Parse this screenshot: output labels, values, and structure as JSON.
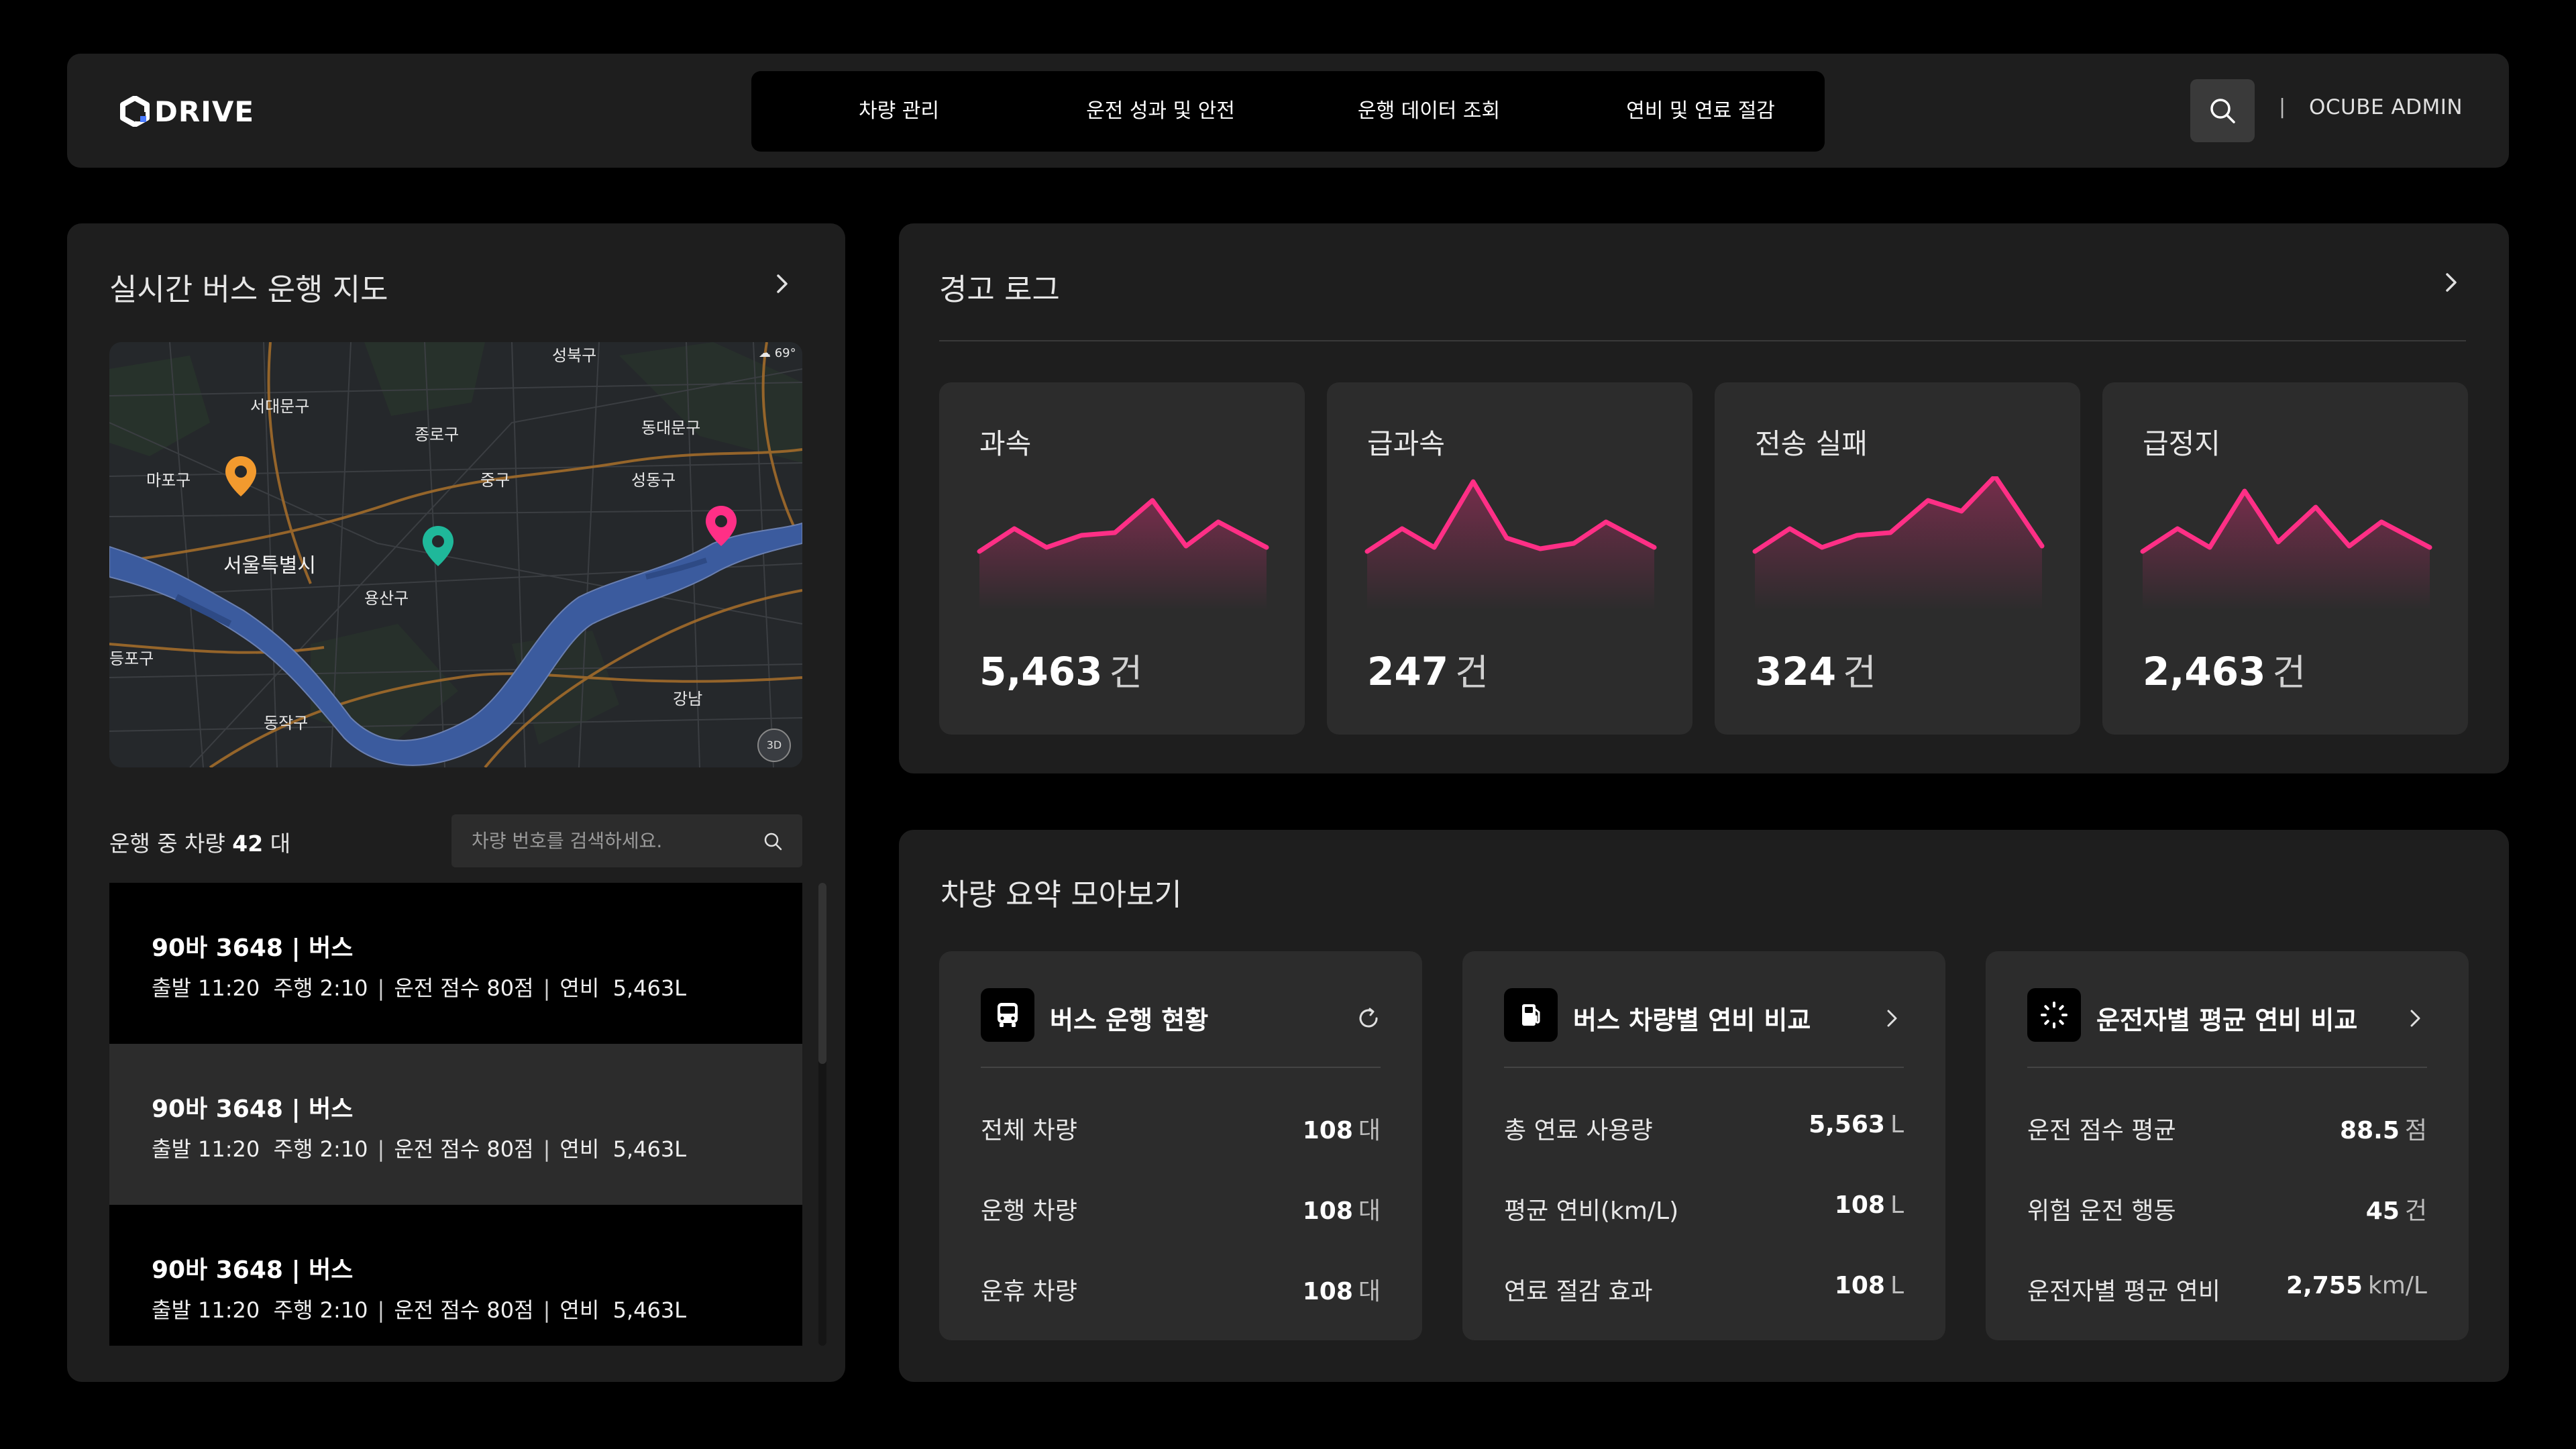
{
  "header": {
    "logo_text": "DRIVE",
    "nav": [
      "차량 관리",
      "운전 성과 및 안전",
      "운행 데이터 조회",
      "연비 및 연료 절감"
    ],
    "separator": "|",
    "admin": "OCUBE ADMIN"
  },
  "map_panel": {
    "title": "실시간 버스 운행 지도",
    "map_labels": [
      "성북구",
      "서대문구",
      "종로구",
      "동대문구",
      "마포구",
      "중구",
      "성동구",
      "서울특별시",
      "용산구",
      "등포구",
      "강남",
      "동작구"
    ],
    "weather": "69°",
    "badge_3d": "3D",
    "pin_colors": [
      "#f29a2e",
      "#1fb89a",
      "#ff2f86"
    ],
    "running_prefix": "운행 중 차량",
    "running_count": "42",
    "running_unit": "대",
    "search_placeholder": "차량 번호를 검색하세요.",
    "vehicles": [
      {
        "name": "90바 3648 | 버스",
        "depart": "출발 11:20",
        "drive": "주행 2:10",
        "score": "운전 점수 80점",
        "fuel_label": "연비",
        "fuel": "5,463L"
      },
      {
        "name": "90바 3648 | 버스",
        "depart": "출발 11:20",
        "drive": "주행 2:10",
        "score": "운전 점수 80점",
        "fuel_label": "연비",
        "fuel": "5,463L"
      },
      {
        "name": "90바 3648 | 버스",
        "depart": "출발 11:20",
        "drive": "주행 2:10",
        "score": "운전 점수 80점",
        "fuel_label": "연비",
        "fuel": "5,463L"
      }
    ]
  },
  "alert_panel": {
    "title": "경고 로그",
    "accent_color": "#ff2f86",
    "cards": [
      {
        "title": "과속",
        "value": "5,463",
        "unit": "건"
      },
      {
        "title": "급과속",
        "value": "247",
        "unit": "건"
      },
      {
        "title": "전송 실패",
        "value": "324",
        "unit": "건"
      },
      {
        "title": "급정지",
        "value": "2,463",
        "unit": "건"
      }
    ]
  },
  "summary_panel": {
    "title": "차량 요약 모아보기",
    "cards": [
      {
        "title": "버스 운행 현황",
        "icon": "bus-icon",
        "action": "refresh-icon",
        "rows": [
          {
            "key": "전체 차량",
            "value": "108",
            "unit": "대"
          },
          {
            "key": "운행 차량",
            "value": "108",
            "unit": "대"
          },
          {
            "key": "운휴 차량",
            "value": "108",
            "unit": "대"
          }
        ]
      },
      {
        "title": "버스 차량별 연비 비교",
        "icon": "fuel-pump-icon",
        "action": "chevron-right-icon",
        "rows": [
          {
            "key": "총 연료 사용량",
            "value": "5,563",
            "unit": "L"
          },
          {
            "key": "평균 연비(km/L)",
            "value": "108",
            "unit": "L"
          },
          {
            "key": "연료 절감 효과",
            "value": "108",
            "unit": "L"
          }
        ]
      },
      {
        "title": "운전자별 평균 연비 비교",
        "icon": "loading-icon",
        "action": "chevron-right-icon",
        "rows": [
          {
            "key": "운전 점수 평균",
            "value": "88.5",
            "unit": "점"
          },
          {
            "key": "위험 운전 행동",
            "value": "45",
            "unit": "건"
          },
          {
            "key": "운전자별 평균 연비",
            "value": "2,755",
            "unit": "km/L"
          }
        ]
      }
    ]
  }
}
